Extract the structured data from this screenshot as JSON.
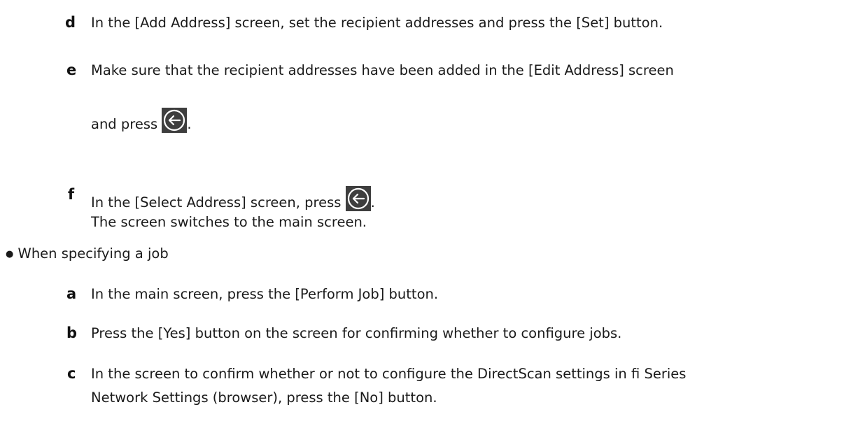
{
  "steps_top": [
    {
      "marker": "d",
      "text": "In the [Add Address] screen, set the recipient addresses and press the [Set] button."
    },
    {
      "marker": "e",
      "text": "Make sure that the recipient addresses have been added in the [Edit Address] screen",
      "text2": "and press",
      "text2_end": "."
    },
    {
      "marker": "f",
      "text": "In the [Select Address] screen, press",
      "text_end": ".",
      "text2": "The screen switches to the main screen."
    }
  ],
  "bullet": {
    "symbol": "●",
    "text": "When specifying a job"
  },
  "steps_job": [
    {
      "marker": "a",
      "text": "In the main screen, press the [Perform Job] button."
    },
    {
      "marker": "b",
      "text": "Press the [Yes] button on the screen for confirming whether to configure jobs."
    },
    {
      "marker": "c",
      "text": "In the screen to confirm whether or not to configure the DirectScan settings in fi Series",
      "text2": "Network Settings (browser), press the [No] button."
    }
  ],
  "icons": {
    "back": "back-arrow-icon"
  },
  "colors": {
    "icon_background": "#3e3e3e",
    "icon_stroke": "#ffffff",
    "text": "#1a1a1a"
  }
}
